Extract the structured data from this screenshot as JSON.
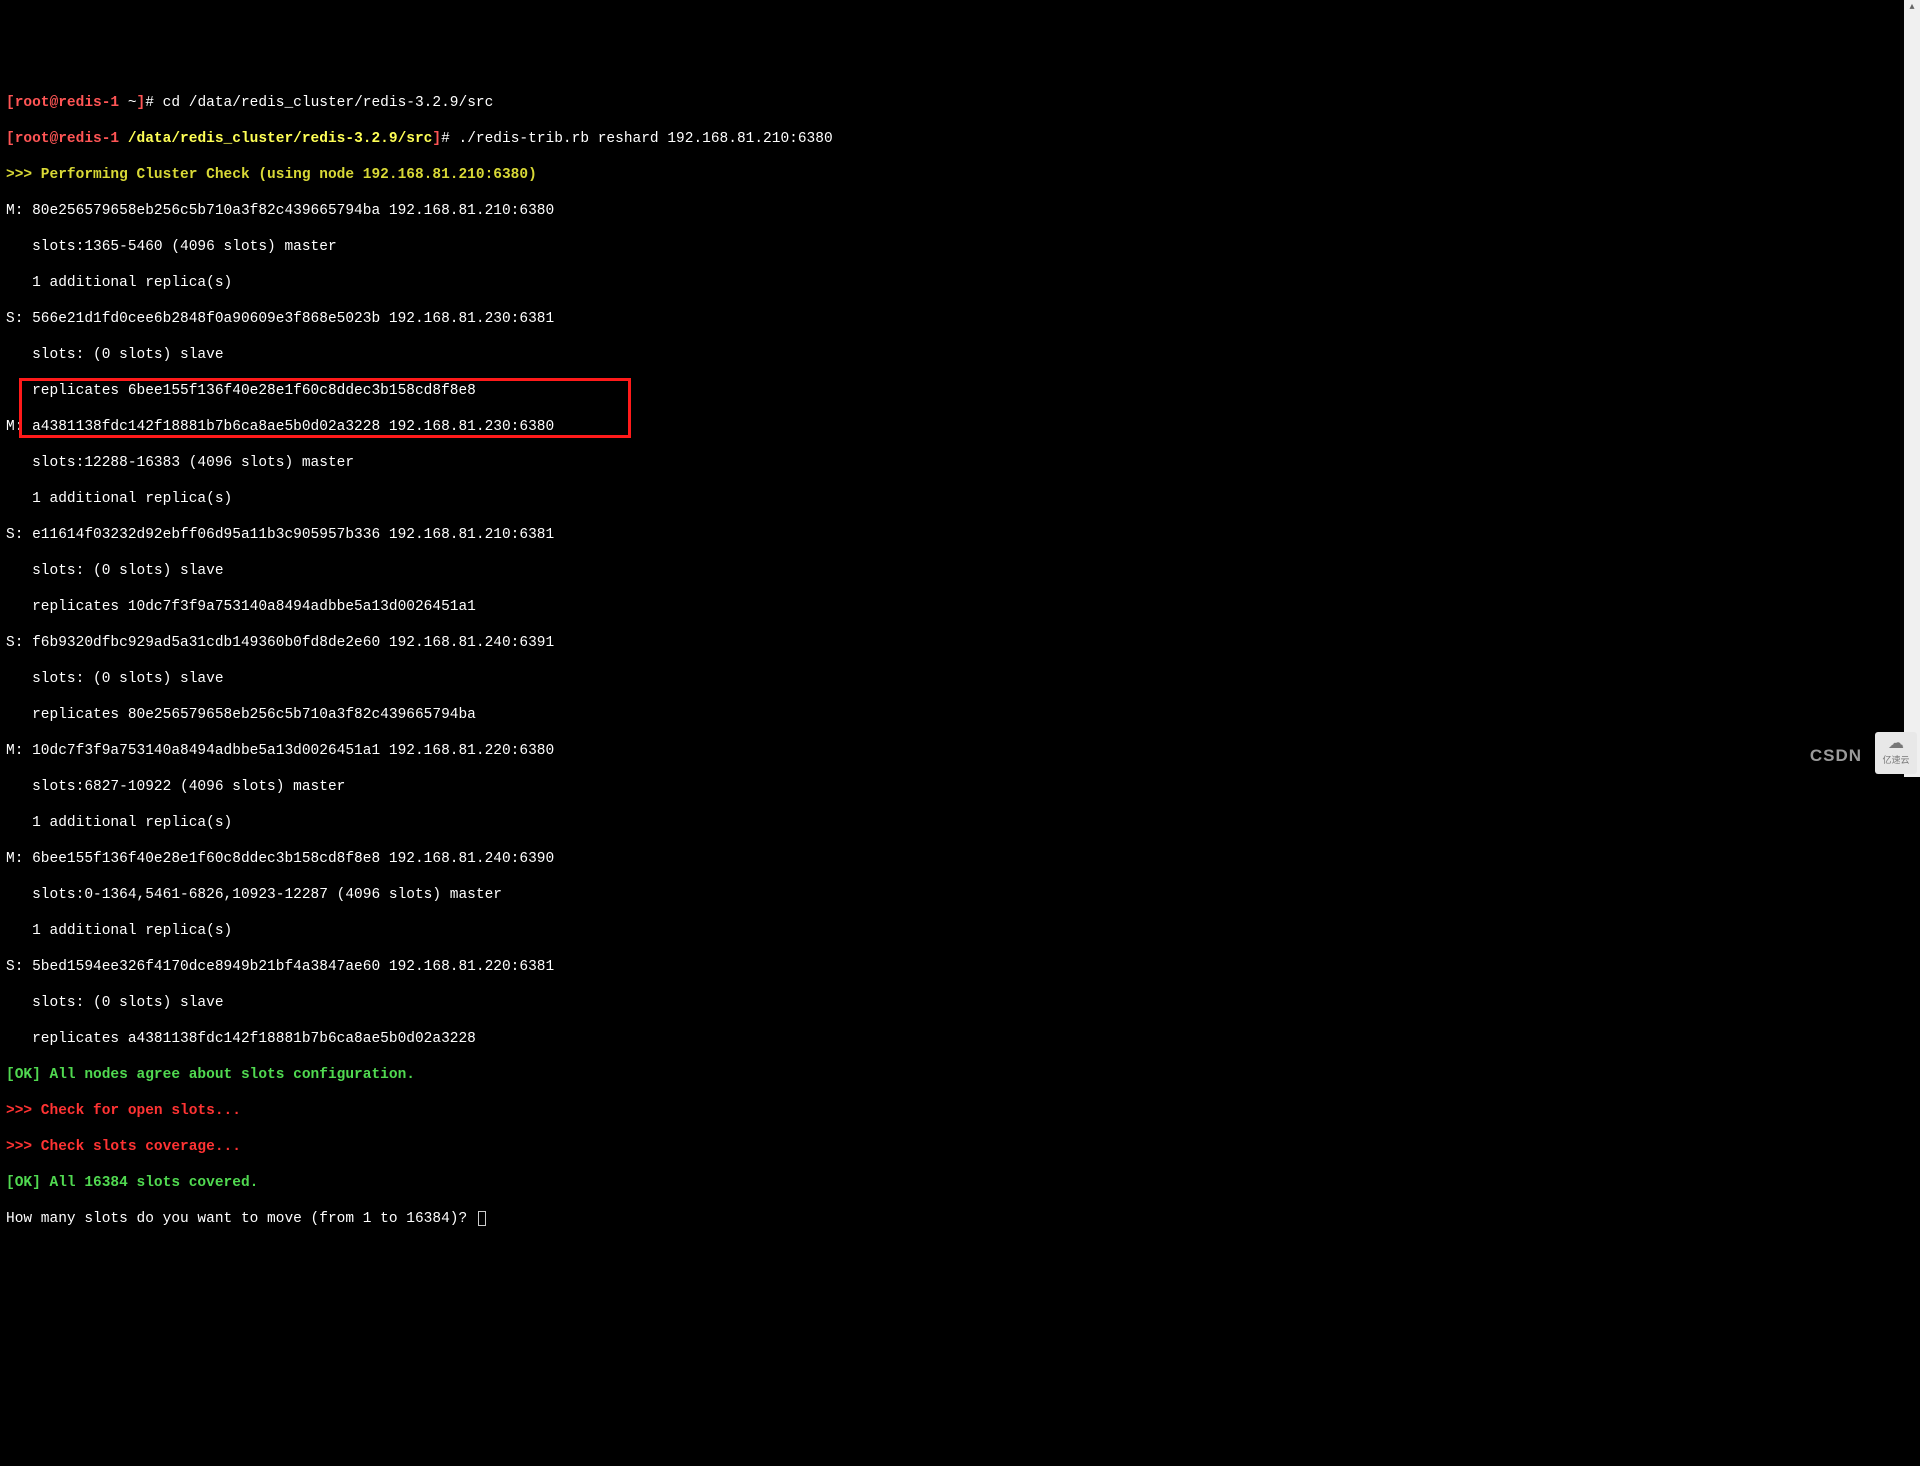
{
  "prompt1": {
    "bracket_open": "[",
    "user_host": "root@redis-1",
    "space_tilde": " ~",
    "bracket_close": "]",
    "hash": "# ",
    "command": "cd /data/redis_cluster/redis-3.2.9/src"
  },
  "prompt2": {
    "bracket_open": "[",
    "user_host": "root@redis-1",
    "space": " ",
    "path": "/data/redis_cluster/redis-3.2.9/src",
    "bracket_close": "]",
    "hash": "# ",
    "command": "./redis-trib.rb reshard 192.168.81.210:6380"
  },
  "cluster_check_header": ">>> Performing Cluster Check (using node 192.168.81.210:6380)",
  "nodes": [
    "M: 80e256579658eb256c5b710a3f82c439665794ba 192.168.81.210:6380",
    "   slots:1365-5460 (4096 slots) master",
    "   1 additional replica(s)",
    "S: 566e21d1fd0cee6b2848f0a90609e3f868e5023b 192.168.81.230:6381",
    "   slots: (0 slots) slave",
    "   replicates 6bee155f136f40e28e1f60c8ddec3b158cd8f8e8",
    "M: a4381138fdc142f18881b7b6ca8ae5b0d02a3228 192.168.81.230:6380",
    "   slots:12288-16383 (4096 slots) master",
    "   1 additional replica(s)",
    "S: e11614f03232d92ebff06d95a11b3c905957b336 192.168.81.210:6381",
    "   slots: (0 slots) slave",
    "   replicates 10dc7f3f9a753140a8494adbbe5a13d0026451a1",
    "S: f6b9320dfbc929ad5a31cdb149360b0fd8de2e60 192.168.81.240:6391",
    "   slots: (0 slots) slave",
    "   replicates 80e256579658eb256c5b710a3f82c439665794ba",
    "M: 10dc7f3f9a753140a8494adbbe5a13d0026451a1 192.168.81.220:6380",
    "   slots:6827-10922 (4096 slots) master",
    "   1 additional replica(s)",
    "M: 6bee155f136f40e28e1f60c8ddec3b158cd8f8e8 192.168.81.240:6390",
    "   slots:0-1364,5461-6826,10923-12287 (4096 slots) master",
    "   1 additional replica(s)",
    "S: 5bed1594ee326f4170dce8949b21bf4a3847ae60 192.168.81.220:6381",
    "   slots: (0 slots) slave",
    "   replicates a4381138fdc142f18881b7b6ca8ae5b0d02a3228"
  ],
  "ok_nodes": "[OK] All nodes agree about slots configuration.",
  "check_open": ">>> Check for open slots...",
  "check_coverage": ">>> Check slots coverage...",
  "ok_slots": "[OK] All 16384 slots covered.",
  "prompt_question": "How many slots do you want to move (from 1 to 16384)? ",
  "watermark": {
    "csdn": "CSDN",
    "yisu": "亿速云"
  }
}
